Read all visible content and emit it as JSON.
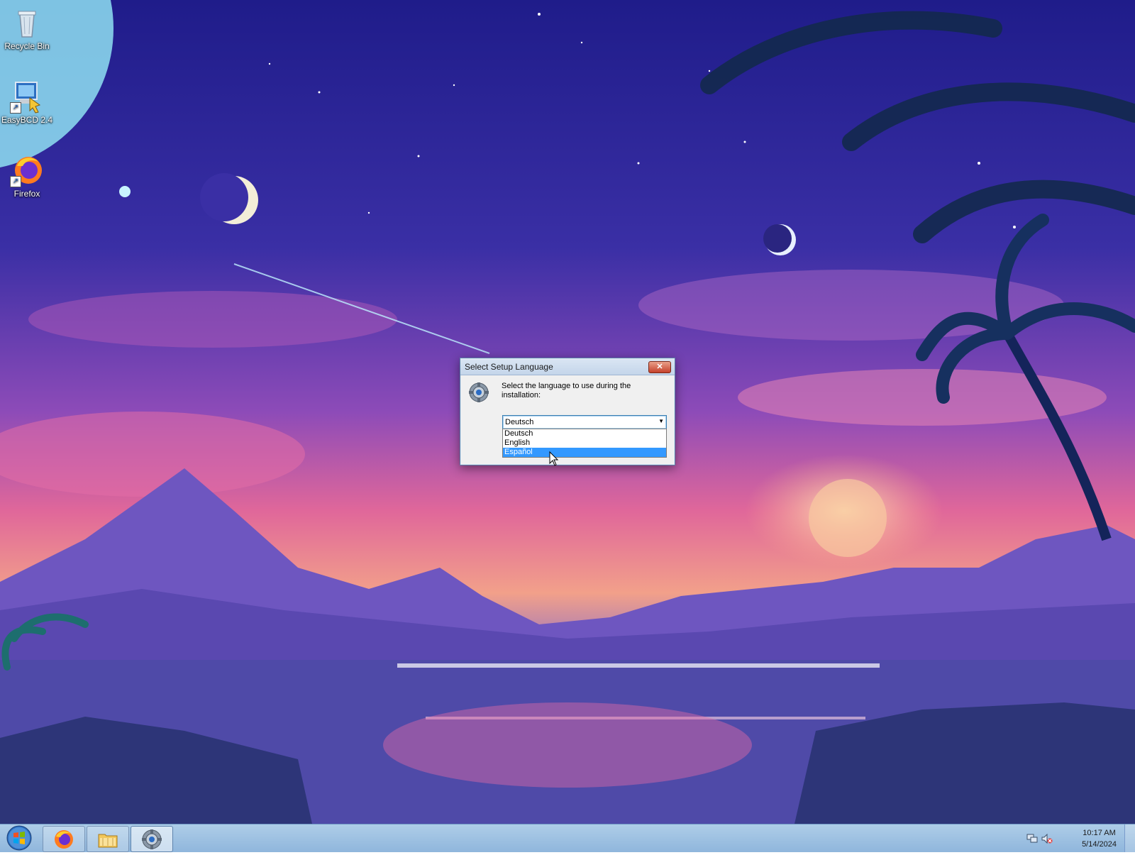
{
  "desktop": {
    "icons": [
      {
        "label": "Recycle Bin",
        "icon": "recycle-bin-icon"
      },
      {
        "label": "EasyBCD 2.4",
        "icon": "easybcd-icon"
      },
      {
        "label": "Firefox",
        "icon": "firefox-icon"
      }
    ]
  },
  "dialog": {
    "title": "Select Setup Language",
    "close_label": "✕",
    "prompt": "Select the language to use during the installation:",
    "selected_value": "Deutsch",
    "options": [
      "Deutsch",
      "English",
      "Español"
    ],
    "highlighted_option": "Español",
    "icon": "setup-gear-icon"
  },
  "taskbar": {
    "buttons": [
      {
        "name": "firefox",
        "icon": "firefox-icon"
      },
      {
        "name": "file-explorer",
        "icon": "folder-icon"
      },
      {
        "name": "setup",
        "icon": "setup-gear-icon",
        "active": true
      }
    ],
    "clock": {
      "time": "10:17 AM",
      "date": "5/14/2024"
    },
    "tray_icons": [
      "network-icon",
      "volume-muted-icon"
    ]
  },
  "colors": {
    "selection": "#3399ff",
    "taskbar": "#9fc3e6",
    "close_button": "#c5412b"
  }
}
